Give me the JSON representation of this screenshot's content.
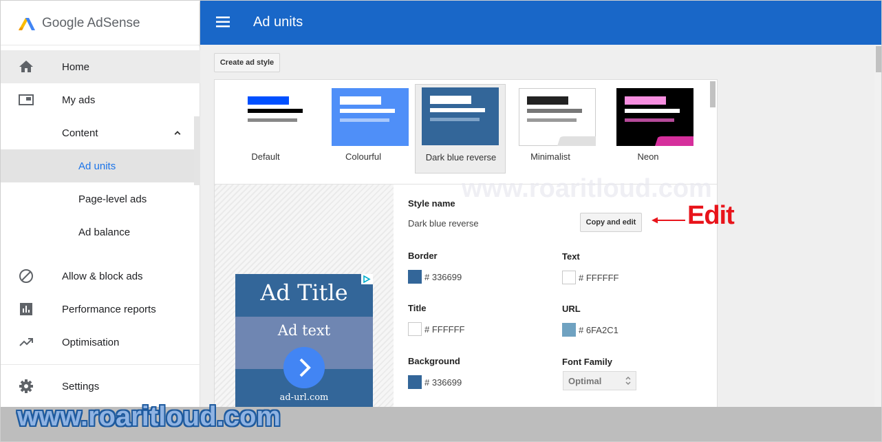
{
  "app": {
    "logo_text": "Google AdSense",
    "header_title": "Ad units"
  },
  "sidebar": {
    "items": [
      {
        "label": "Home",
        "icon": "home-icon"
      },
      {
        "label": "My ads",
        "icon": "ads-icon"
      },
      {
        "label": "Content",
        "icon": "chevron-up-icon"
      },
      {
        "label": "Ad units"
      },
      {
        "label": "Page-level ads"
      },
      {
        "label": "Ad balance"
      },
      {
        "label": "Allow & block ads",
        "icon": "block-icon"
      },
      {
        "label": "Performance reports",
        "icon": "bar-chart-icon"
      },
      {
        "label": "Optimisation",
        "icon": "trending-up-icon"
      },
      {
        "label": "Settings",
        "icon": "gear-icon"
      }
    ]
  },
  "toolbar": {
    "create_label": "Create ad style"
  },
  "styles": [
    {
      "name": "Default"
    },
    {
      "name": "Colourful"
    },
    {
      "name": "Dark blue reverse",
      "selected": true
    },
    {
      "name": "Minimalist"
    },
    {
      "name": "Neon"
    }
  ],
  "preview": {
    "title": "Ad Title",
    "text": "Ad text",
    "url": "ad-url.com"
  },
  "form": {
    "style_name_label": "Style name",
    "style_name_value": "Dark blue reverse",
    "copy_edit_label": "Copy and edit",
    "border_label": "Border",
    "border_hex": "# 336699",
    "text_label": "Text",
    "text_hex": "# FFFFFF",
    "title_label": "Title",
    "title_hex": "# FFFFFF",
    "url_label": "URL",
    "url_hex": "# 6FA2C1",
    "background_label": "Background",
    "background_hex": "# 336699",
    "font_family_label": "Font Family",
    "font_family_value": "Optimal"
  },
  "colors": {
    "header_blue": "#1967c8",
    "border_swatch": "#336699",
    "text_swatch": "#FFFFFF",
    "title_swatch": "#FFFFFF",
    "url_swatch": "#6FA2C1",
    "background_swatch": "#336699"
  },
  "annotations": {
    "edit_label": "Edit",
    "watermark": "www.roaritloud.com",
    "faint_watermark": "www.roaritloud.com"
  }
}
